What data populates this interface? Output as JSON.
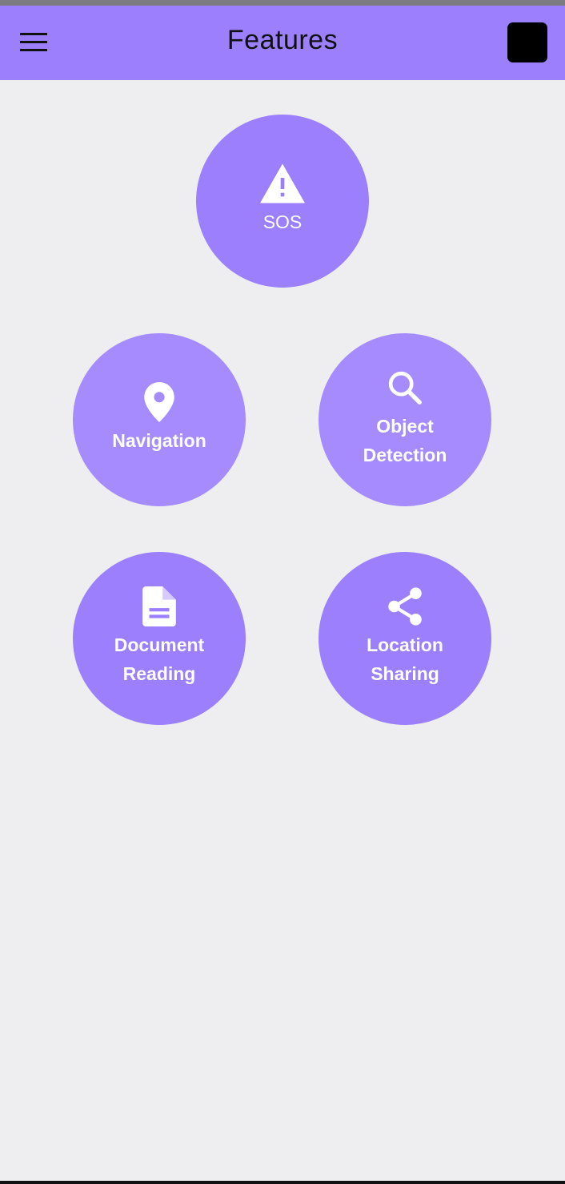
{
  "app_bar": {
    "title": "Features",
    "menu_icon": "hamburger-menu-icon",
    "action_icon": "black-square-icon"
  },
  "colors": {
    "primary": "#9b7ffd",
    "background": "#eeeef0",
    "on_primary": "#ffffff"
  },
  "features": {
    "sos": {
      "label": "SOS",
      "icon": "warning-icon"
    },
    "navigation": {
      "label": "Navigation",
      "icon": "location-pin-icon"
    },
    "object_detection": {
      "label_line1": "Object",
      "label_line2": "Detection",
      "icon": "search-icon"
    },
    "document_reading": {
      "label_line1": "Document",
      "label_line2": "Reading",
      "icon": "document-icon"
    },
    "location_sharing": {
      "label_line1": "Location",
      "label_line2": "Sharing",
      "icon": "share-icon"
    }
  }
}
